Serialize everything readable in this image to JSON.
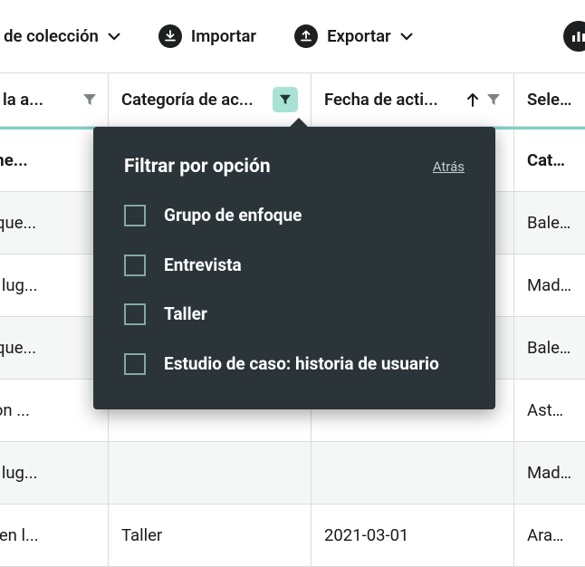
{
  "toolbar": {
    "link_label": "ace de colección",
    "import_label": "Importar",
    "export_label": "Exportar"
  },
  "columns": {
    "c0": "de la a...",
    "c1": "Categoría de ac...",
    "c2": "Fecha de acti...",
    "c3": "Selecc"
  },
  "rows": [
    {
      "c0": "ndame...",
      "c3": "Catalu",
      "bold": true
    },
    {
      "c0": "enfoque...",
      "c3": "Balears"
    },
    {
      "c0": "a los lug...",
      "c3": "Madrid"
    },
    {
      "c0": "enfoque...",
      "c3": "Balears"
    },
    {
      "c0": "up con ...",
      "c3": "Asturia"
    },
    {
      "c0": "a los lug...",
      "c3": "Madrid"
    },
    {
      "c0": "ASH en l...",
      "c1": "Taller",
      "c2": "2021-03-01",
      "c3": "Aragon"
    }
  ],
  "filter": {
    "title": "Filtrar por opción",
    "back": "Atrás",
    "options": [
      "Grupo de enfoque",
      "Entrevista",
      "Taller",
      "Estudio de caso: historia de usuario"
    ]
  }
}
